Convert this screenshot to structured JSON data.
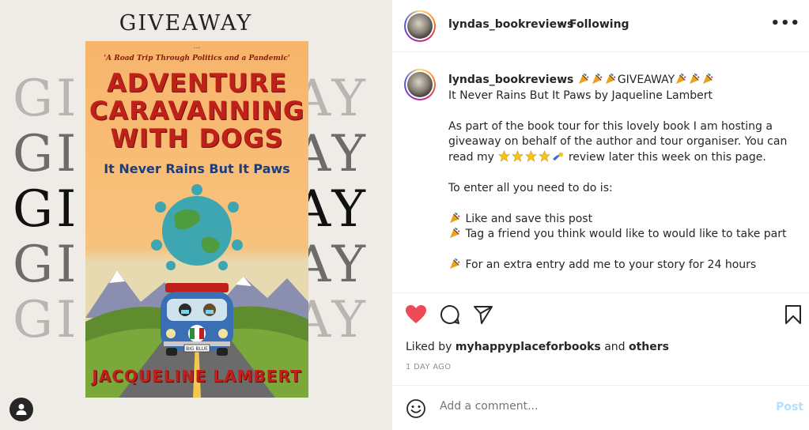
{
  "media": {
    "title": "GIVEAWAY",
    "bg_left_letters": "GI",
    "bg_right_letters": "AY",
    "cover": {
      "dots": "...",
      "tagline": "'A Road Trip Through Politics and a Pandemic'",
      "title_lines": [
        "ADVENTURE",
        "CARAVANNING",
        "WITH DOGS"
      ],
      "subtitle": "It Never Rains But It Paws",
      "plate": "BIG BLUE",
      "author": "JACQUELINE LAMBERT"
    }
  },
  "header": {
    "username": "lyndas_bookreviews",
    "separator": "•",
    "follow_status": "Following",
    "more_icon": "ellipsis-icon"
  },
  "caption": {
    "username": "lyndas_bookreviews",
    "headline_word": "GIVEAWAY",
    "book_line": "It Never Rains But It Paws by Jaqueline Lambert",
    "para1_a": "As part of the book tour for this lovely book I am hosting a giveaway on behalf of the author and tour organiser. You can read my",
    "para1_b": "review later this week on this page.",
    "para2": "To enter all you need to do is:",
    "bullet1": "Like and save this post",
    "bullet2": "Tag a friend you think would like to would like to take part",
    "bullet3": "For an extra entry add me to your story for 24 hours"
  },
  "actions": {
    "liked_prefix": "Liked by",
    "liked_user": "myhappyplaceforbooks",
    "liked_and": "and",
    "liked_others": "others",
    "date": "1 DAY AGO"
  },
  "comment": {
    "placeholder": "Add a comment...",
    "post_label": "Post"
  },
  "colors": {
    "like_red": "#ed4956",
    "post_disabled": "#b2dffc",
    "muted": "#8e8e8e"
  }
}
